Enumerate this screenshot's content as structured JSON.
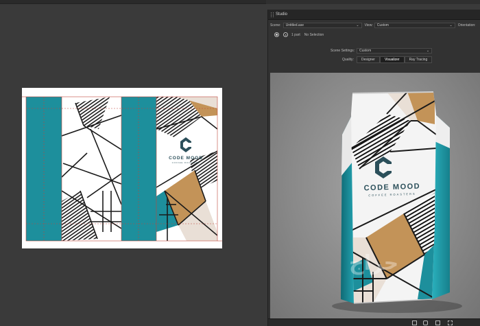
{
  "studio": {
    "title": "Studio",
    "scene_label": "Scene:",
    "scene_value": "Untitled.ase",
    "view_label": "View:",
    "view_value": "Custom",
    "orientation_label": "Orientation:",
    "part_count": "1 part",
    "selection_status": "No Selection",
    "scene_settings_label": "Scene Settings:",
    "scene_settings_value": "Custom",
    "quality_label": "Quality:",
    "quality_tabs": [
      "Designer",
      "Visualizer",
      "Ray Tracing"
    ],
    "quality_selected": "Visualizer"
  },
  "brand": {
    "name": "CODE MOOD",
    "tagline": "COFFEE ROASTERS"
  },
  "watermark": "حراج",
  "colors": {
    "teal": "#1d8f9c",
    "tan": "#c39358",
    "beige": "#e9dfd6",
    "dieline": "#c0473b"
  },
  "icons": [
    "play-icon",
    "record-icon",
    "chevron-down-icon",
    "grid-icon",
    "camera-icon",
    "window-icon",
    "fullscreen-icon"
  ]
}
